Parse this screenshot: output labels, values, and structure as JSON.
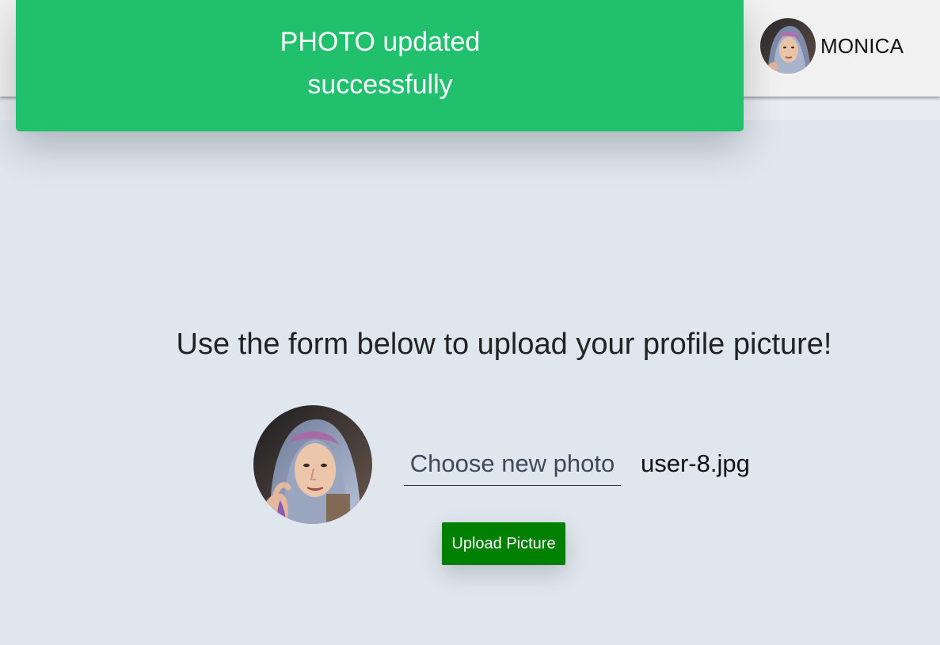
{
  "toast": {
    "line1": "PHOTO updated",
    "line2": "successfully",
    "color": "#20c06c"
  },
  "user_menu": {
    "name": "MONICA",
    "avatar_icon": "user-avatar-photo"
  },
  "main": {
    "heading": "Use the form below to upload your profile picture!",
    "preview_icon": "profile-photo-preview",
    "file_label": "Choose new photo",
    "file_name": "user-8.jpg",
    "upload_label": "Upload Picture",
    "upload_color": "#008000"
  },
  "colors": {
    "background": "#dfe6ee",
    "header": "#f1f1f1"
  }
}
